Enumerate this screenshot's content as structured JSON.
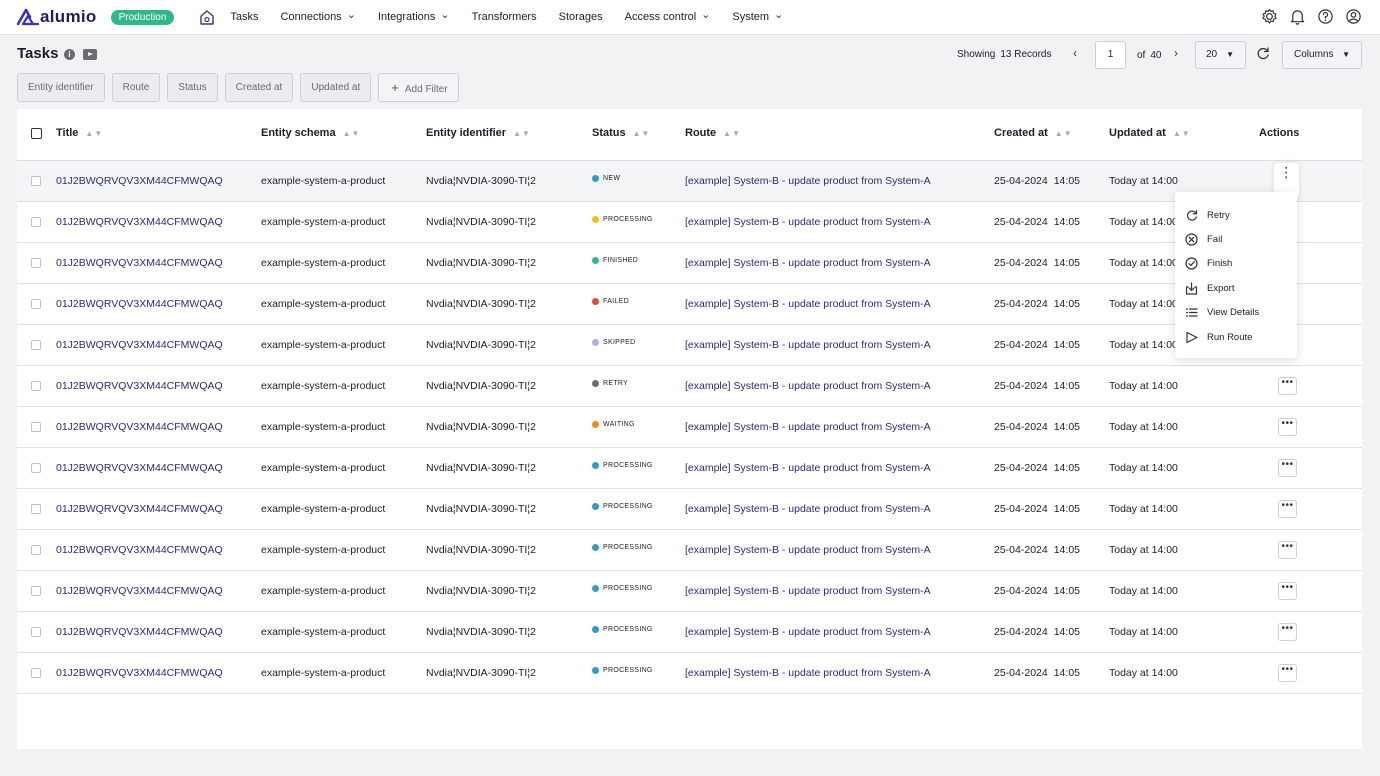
{
  "nav": {
    "logo": "alumio",
    "environment": "Production",
    "items": [
      {
        "label": "Tasks",
        "dropdown": false
      },
      {
        "label": "Connections",
        "dropdown": true
      },
      {
        "label": "Integrations",
        "dropdown": true
      },
      {
        "label": "Transformers",
        "dropdown": false
      },
      {
        "label": "Storages",
        "dropdown": false
      },
      {
        "label": "Access control",
        "dropdown": true
      },
      {
        "label": "System",
        "dropdown": true
      }
    ],
    "icons": [
      "settings-icon",
      "bell-icon",
      "help-icon",
      "user-icon"
    ]
  },
  "header": {
    "title": "Tasks",
    "showing_label": "Showing",
    "records": "13 Records",
    "page": "1",
    "of_label": "of",
    "total_pages": "40",
    "per_page": "20",
    "columns_label": "Columns"
  },
  "filters": [
    "Entity identifier",
    "Route",
    "Status",
    "Created at",
    "Updated at"
  ],
  "add_filter_label": "Add Filter",
  "table": {
    "columns": {
      "title": "Title",
      "schema": "Entity schema",
      "identifier": "Entity identifier",
      "status": "Status",
      "route": "Route",
      "created": "Created at",
      "updated": "Updated at",
      "actions": "Actions"
    },
    "rows": [
      {
        "title": "01J2BWQRVQV3XM44CFMWQAQ",
        "schema": "example-system-a-product",
        "identifier": "Nvdia¦NVDIA-3090-TI¦2",
        "status": "NEW",
        "status_color": "#2b9fc7",
        "route": "[example] System-B - update product from System-A",
        "created_date": "25-04-2024",
        "created_time": "14:05",
        "updated": "Today at 14:00"
      },
      {
        "title": "01J2BWQRVQV3XM44CFMWQAQ",
        "schema": "example-system-a-product",
        "identifier": "Nvdia¦NVDIA-3090-TI¦2",
        "status": "PROCESSING",
        "status_color": "#e8c21b",
        "route": "[example] System-B - update product from System-A",
        "created_date": "25-04-2024",
        "created_time": "14:05",
        "updated": "Today at 14:00"
      },
      {
        "title": "01J2BWQRVQV3XM44CFMWQAQ",
        "schema": "example-system-a-product",
        "identifier": "Nvdia¦NVDIA-3090-TI¦2",
        "status": "FINISHED",
        "status_color": "#2fb88a",
        "route": "[example] System-B - update product from System-A",
        "created_date": "25-04-2024",
        "created_time": "14:05",
        "updated": "Today at 14:00"
      },
      {
        "title": "01J2BWQRVQV3XM44CFMWQAQ",
        "schema": "example-system-a-product",
        "identifier": "Nvdia¦NVDIA-3090-TI¦2",
        "status": "FAILED",
        "status_color": "#e5483d",
        "route": "[example] System-B - update product from System-A",
        "created_date": "25-04-2024",
        "created_time": "14:05",
        "updated": "Today at 14:00"
      },
      {
        "title": "01J2BWQRVQV3XM44CFMWQAQ",
        "schema": "example-system-a-product",
        "identifier": "Nvdia¦NVDIA-3090-TI¦2",
        "status": "SKIPPED",
        "status_color": "#b8a9e8",
        "route": "[example] System-B - update product from System-A",
        "created_date": "25-04-2024",
        "created_time": "14:05",
        "updated": "Today at 14:00"
      },
      {
        "title": "01J2BWQRVQV3XM44CFMWQAQ",
        "schema": "example-system-a-product",
        "identifier": "Nvdia¦NVDIA-3090-TI¦2",
        "status": "RETRY",
        "status_color": "#6b6c72",
        "route": "[example] System-B - update product from System-A",
        "created_date": "25-04-2024",
        "created_time": "14:05",
        "updated": "Today at 14:00"
      },
      {
        "title": "01J2BWQRVQV3XM44CFMWQAQ",
        "schema": "example-system-a-product",
        "identifier": "Nvdia¦NVDIA-3090-TI¦2",
        "status": "WAITING",
        "status_color": "#ec8a1c",
        "route": "[example] System-B - update product from System-A",
        "created_date": "25-04-2024",
        "created_time": "14:05",
        "updated": "Today at 14:00"
      },
      {
        "title": "01J2BWQRVQV3XM44CFMWQAQ",
        "schema": "example-system-a-product",
        "identifier": "Nvdia¦NVDIA-3090-TI¦2",
        "status": "PROCESSING",
        "status_color": "#2b9fc7",
        "route": "[example] System-B - update product from System-A",
        "created_date": "25-04-2024",
        "created_time": "14:05",
        "updated": "Today at 14:00"
      },
      {
        "title": "01J2BWQRVQV3XM44CFMWQAQ",
        "schema": "example-system-a-product",
        "identifier": "Nvdia¦NVDIA-3090-TI¦2",
        "status": "PROCESSING",
        "status_color": "#2b9fc7",
        "route": "[example] System-B - update product from System-A",
        "created_date": "25-04-2024",
        "created_time": "14:05",
        "updated": "Today at 14:00"
      },
      {
        "title": "01J2BWQRVQV3XM44CFMWQAQ",
        "schema": "example-system-a-product",
        "identifier": "Nvdia¦NVDIA-3090-TI¦2",
        "status": "PROCESSING",
        "status_color": "#2b9fc7",
        "route": "[example] System-B - update product from System-A",
        "created_date": "25-04-2024",
        "created_time": "14:05",
        "updated": "Today at 14:00"
      },
      {
        "title": "01J2BWQRVQV3XM44CFMWQAQ",
        "schema": "example-system-a-product",
        "identifier": "Nvdia¦NVDIA-3090-TI¦2",
        "status": "PROCESSING",
        "status_color": "#2b9fc7",
        "route": "[example] System-B - update product from System-A",
        "created_date": "25-04-2024",
        "created_time": "14:05",
        "updated": "Today at 14:00"
      },
      {
        "title": "01J2BWQRVQV3XM44CFMWQAQ",
        "schema": "example-system-a-product",
        "identifier": "Nvdia¦NVDIA-3090-TI¦2",
        "status": "PROCESSING",
        "status_color": "#2b9fc7",
        "route": "[example] System-B - update product from System-A",
        "created_date": "25-04-2024",
        "created_time": "14:05",
        "updated": "Today at 14:00"
      },
      {
        "title": "01J2BWQRVQV3XM44CFMWQAQ",
        "schema": "example-system-a-product",
        "identifier": "Nvdia¦NVDIA-3090-TI¦2",
        "status": "PROCESSING",
        "status_color": "#2b9fc7",
        "route": "[example] System-B - update product from System-A",
        "created_date": "25-04-2024",
        "created_time": "14:05",
        "updated": "Today at 14:00"
      }
    ]
  },
  "action_menu": {
    "open_row": 0,
    "items": [
      {
        "label": "Retry",
        "icon": "retry-icon"
      },
      {
        "label": "Fail",
        "icon": "fail-icon"
      },
      {
        "label": "Finish",
        "icon": "finish-icon"
      },
      {
        "label": "Export",
        "icon": "export-icon"
      },
      {
        "label": "View Details",
        "icon": "list-icon"
      },
      {
        "label": "Run Route",
        "icon": "play-icon"
      }
    ]
  },
  "colors": {
    "brand": "#2c2a7c",
    "production_badge": "#2fb88a"
  }
}
